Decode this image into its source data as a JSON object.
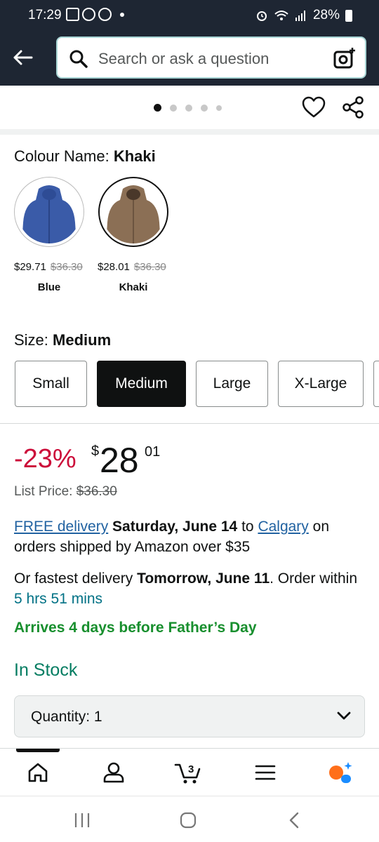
{
  "status_bar": {
    "time": "17:29",
    "battery": "28%"
  },
  "search": {
    "placeholder": "Search or ask a question"
  },
  "carousel": {
    "dot_count": 5,
    "active_index": 0
  },
  "colour": {
    "label": "Colour Name:",
    "selected": "Khaki",
    "options": [
      {
        "name": "Blue",
        "price": "$29.71",
        "list_price": "$36.30",
        "color": "#3a5ba8"
      },
      {
        "name": "Khaki",
        "price": "$28.01",
        "list_price": "$36.30",
        "color": "#8b6f55"
      }
    ]
  },
  "size": {
    "label": "Size:",
    "selected": "Medium",
    "options": [
      "Small",
      "Medium",
      "Large",
      "X-Large"
    ]
  },
  "price": {
    "discount": "-23%",
    "currency": "$",
    "whole": "28",
    "fraction": "01",
    "list_label": "List Price:",
    "list_value": "$36.30"
  },
  "delivery": {
    "link": "FREE delivery",
    "date": "Saturday, June 14",
    "to": "to",
    "location": "Calgary",
    "suffix_1": "on",
    "suffix_2": "orders shipped by Amazon over $35",
    "fastest_prefix": "Or fastest delivery",
    "fastest_date": "Tomorrow, June 11",
    "order_within": ". Order within",
    "countdown": "5 hrs 51 mins"
  },
  "arrives_note": "Arrives 4 days before Father’s Day",
  "stock": "In Stock",
  "quantity": {
    "label": "Quantity: 1"
  },
  "cart_count": "3",
  "colors": {
    "header_bg": "#1e2633",
    "discount": "#cc0c39",
    "link": "#2162a1",
    "teal": "#007185",
    "green": "#067d62",
    "rufus_orange": "#ff6f1a",
    "rufus_blue": "#1a8cff"
  }
}
